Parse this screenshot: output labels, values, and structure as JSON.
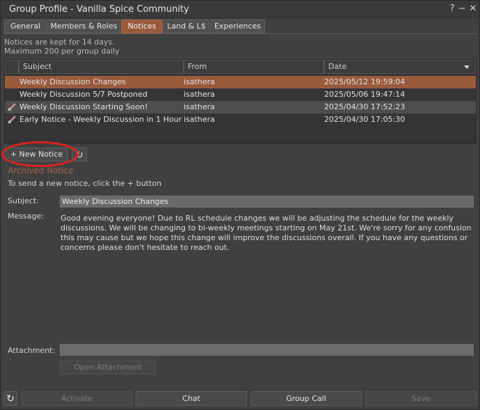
{
  "window": {
    "title": "Group Profile - Vanilla Spice Community",
    "help_glyph": "?",
    "minimize_glyph": "−",
    "close_glyph": "✕"
  },
  "tabs": [
    {
      "label": "General",
      "active": false
    },
    {
      "label": "Members & Roles",
      "active": false
    },
    {
      "label": "Notices",
      "active": true
    },
    {
      "label": "Land & L$",
      "active": false
    },
    {
      "label": "Experiences",
      "active": false
    }
  ],
  "info": {
    "line1": "Notices are kept for 14 days.",
    "line2": "Maximum 200 per group daily"
  },
  "table": {
    "columns": {
      "subject": "Subject",
      "from": "From",
      "date": "Date"
    },
    "rows": [
      {
        "subject": "Weekly Discussion Changes",
        "from": "isathera",
        "date": "2025/05/12 19:59:04",
        "has_attachment": false,
        "state": "selected"
      },
      {
        "subject": "Weekly Discussion 5/7 Postponed",
        "from": "isathera",
        "date": "2025/05/06 19:47:14",
        "has_attachment": false,
        "state": "normal"
      },
      {
        "subject": "Weekly Discussion Starting Soon!",
        "from": "isathera",
        "date": "2025/04/30 17:52:23",
        "has_attachment": true,
        "state": "hover"
      },
      {
        "subject": "Early Notice - Weekly Discussion in 1 Hour",
        "from": "isathera",
        "date": "2025/04/30 17:05:30",
        "has_attachment": true,
        "state": "normal"
      }
    ]
  },
  "actions": {
    "new_notice_label": "+ New Notice",
    "refresh_glyph": "↻"
  },
  "notice": {
    "section_title": "Archived Notice",
    "instruction": "To send a new notice, click the + button",
    "subject_label": "Subject:",
    "subject_value": "Weekly Discussion Changes",
    "message_label": "Message:",
    "message_text": "Good evening everyone! Due to RL schedule changes we will be adjusting the schedule for the weekly discussions. We will be changing to bi-weekly meetings starting on May 21st. We're sorry for any confusion this may cause but we hope this change will improve the discussions overall. If you have any questions or concerns please don't hesitate to reach out.",
    "attachment_label": "Attachment:",
    "attachment_value": "",
    "open_attachment_label": "Open Attachment"
  },
  "footer": {
    "refresh_glyph": "↻",
    "activate_label": "Activate",
    "chat_label": "Chat",
    "group_call_label": "Group Call",
    "save_label": "Save"
  },
  "colors": {
    "accent": "#9a5a3c",
    "highlight_circle": "#e0231d"
  }
}
